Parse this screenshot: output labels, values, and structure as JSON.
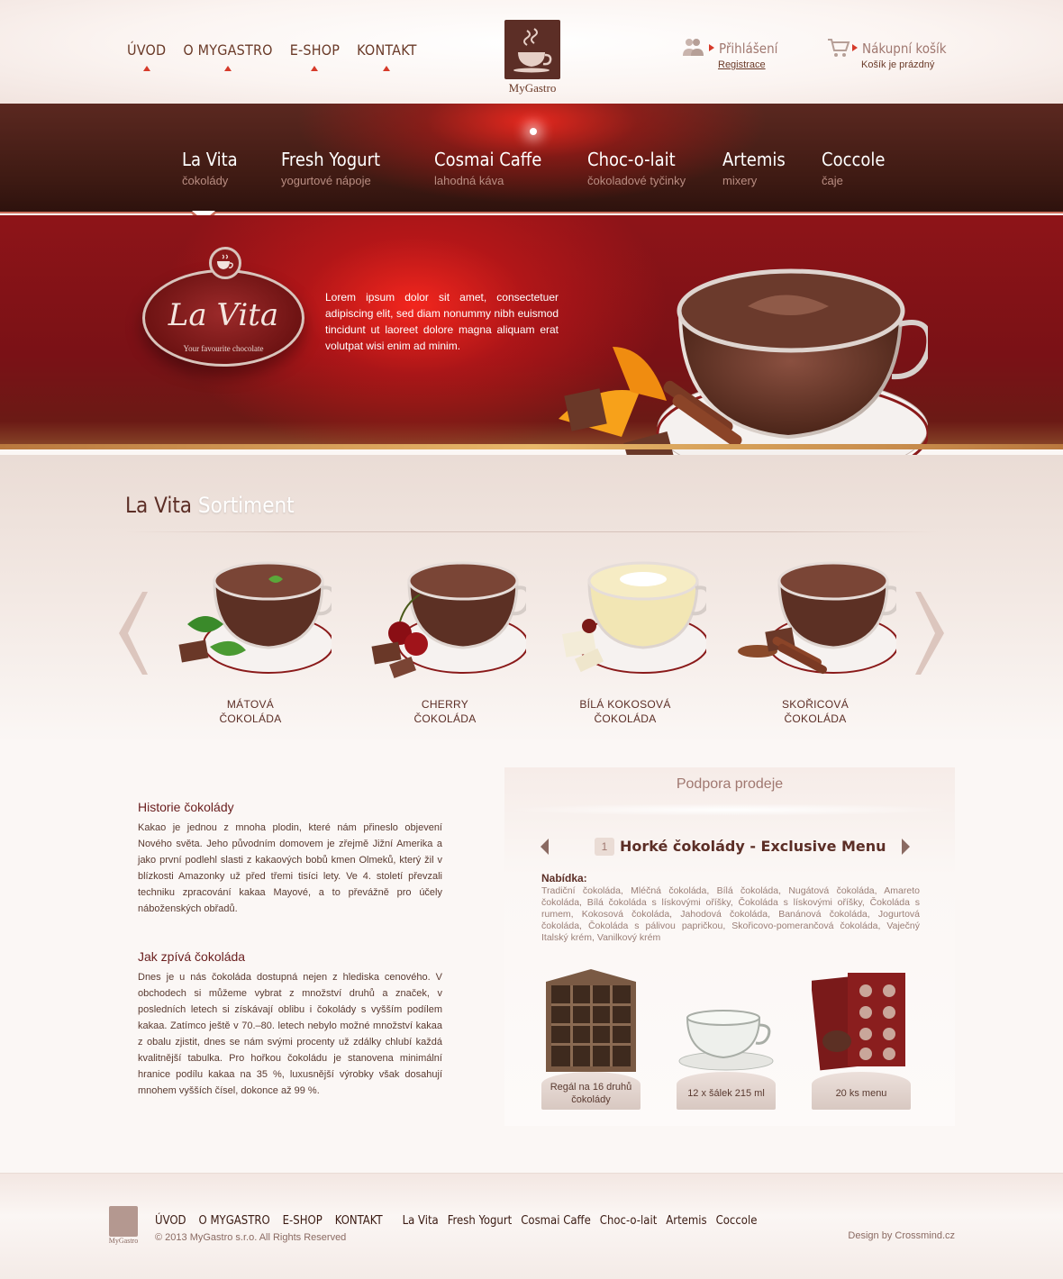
{
  "top_nav": [
    {
      "label": "ÚVOD"
    },
    {
      "label": "O MYGASTRO"
    },
    {
      "label": "E-SHOP"
    },
    {
      "label": "KONTAKT"
    }
  ],
  "logo": {
    "name": "MyGastro"
  },
  "account": {
    "login": "Přihlášení",
    "register": "Registrace"
  },
  "cart": {
    "label": "Nákupní košík",
    "status": "Košík je prázdný"
  },
  "categories": [
    {
      "title": "La Vita",
      "subtitle": "čokolády"
    },
    {
      "title": "Fresh Yogurt",
      "subtitle": "yogurtové nápoje"
    },
    {
      "title": "Cosmai Caffe",
      "subtitle": "lahodná káva"
    },
    {
      "title": "Choc-o-lait",
      "subtitle": "čokoladové tyčinky"
    },
    {
      "title": "Artemis",
      "subtitle": "mixery"
    },
    {
      "title": "Coccole",
      "subtitle": "čaje"
    }
  ],
  "hero": {
    "badge_script": "La Vita",
    "badge_tagline": "Your favourite chocolate",
    "text": "Lorem ipsum dolor sit amet, consectetuer adipiscing elit, sed diam nonummy nibh euismod tincidunt ut laoreet dolore magna aliquam erat volutpat wisi enim ad minim."
  },
  "sortiment": {
    "title_dark": "La Vita",
    "title_light": "Sortiment",
    "products": [
      {
        "line1": "MÁTOVÁ",
        "line2": "ČOKOLÁDA"
      },
      {
        "line1": "CHERRY",
        "line2": "ČOKOLÁDA"
      },
      {
        "line1": "BÍLÁ KOKOSOVÁ",
        "line2": "ČOKOLÁDA"
      },
      {
        "line1": "SKOŘICOVÁ",
        "line2": "ČOKOLÁDA"
      }
    ]
  },
  "history": {
    "h1": "Historie čokolády",
    "p1": "Kakao je jednou z mnoha plodin, které nám přineslo objevení Nového světa. Jeho původním domovem je zřejmě Jižní Amerika a jako první podlehl slasti z kakaových bobů kmen Olmeků, který žil v blízkosti Amazonky už před třemi tisíci lety. Ve 4. století převzali techniku zpracování kakaa Mayové, a to převážně pro účely náboženských obřadů.",
    "h2": "Jak zpívá čokoláda",
    "p2": "Dnes je u nás čokoláda dostupná nejen z hlediska cenového. V obchodech si můžeme vybrat z množství druhů a značek, v posledních letech si získávají oblibu i čokolády s vyšším podílem kakaa. Zatímco ještě v 70.–80. letech nebylo možné množství kakaa z obalu zjistit, dnes se nám svými procenty už zdálky chlubí každá kvalitnější tabulka. Pro hořkou čokoládu je stanovena minimální hranice podílu kakaa na 35 %, luxusnější výrobky však dosahují mnohem vyšších čísel, dokonce až 99 %."
  },
  "support": {
    "title": "Podpora prodeje",
    "menu_number": "1",
    "menu_title": "Horké čokolády - Exclusive Menu",
    "offer_label": "Nabídka:",
    "offer_text": "Tradiční čokoláda, Mléčná čokoláda, Bílá čokoláda, Nugátová čokoláda, Amareto čokoláda, Bílá čokoláda s lískovými oříšky, Čokoláda s lískovými oříšky, Čokoláda s rumem, Kokosová čokoláda, Jahodová čokoláda, Banánová čokoláda, Jogurtová čokoláda, Čokoláda s pálivou papričkou, Skořicovo-pomerančová čokoláda, Vaječný Italský krém, Vanilkový krém",
    "items": [
      {
        "caption": "Regál na 16 druhů čokolády"
      },
      {
        "caption": "12 x šálek 215 ml"
      },
      {
        "caption": "20 ks menu"
      }
    ]
  },
  "footer": {
    "logo_name": "MyGastro",
    "links_a": [
      "ÚVOD",
      "O MYGASTRO",
      "E-SHOP",
      "KONTAKT"
    ],
    "links_b": [
      "La Vita",
      "Fresh Yogurt",
      "Cosmai Caffe",
      "Choc-o-lait",
      "Artemis",
      "Coccole"
    ],
    "copyright": "© 2013 MyGastro s.r.o. All Rights Reserved",
    "design": "Design by Crossmind.cz"
  },
  "colors": {
    "accent": "#d63a2a",
    "brown": "#5c2e26",
    "hero_red": "#8e1418"
  }
}
